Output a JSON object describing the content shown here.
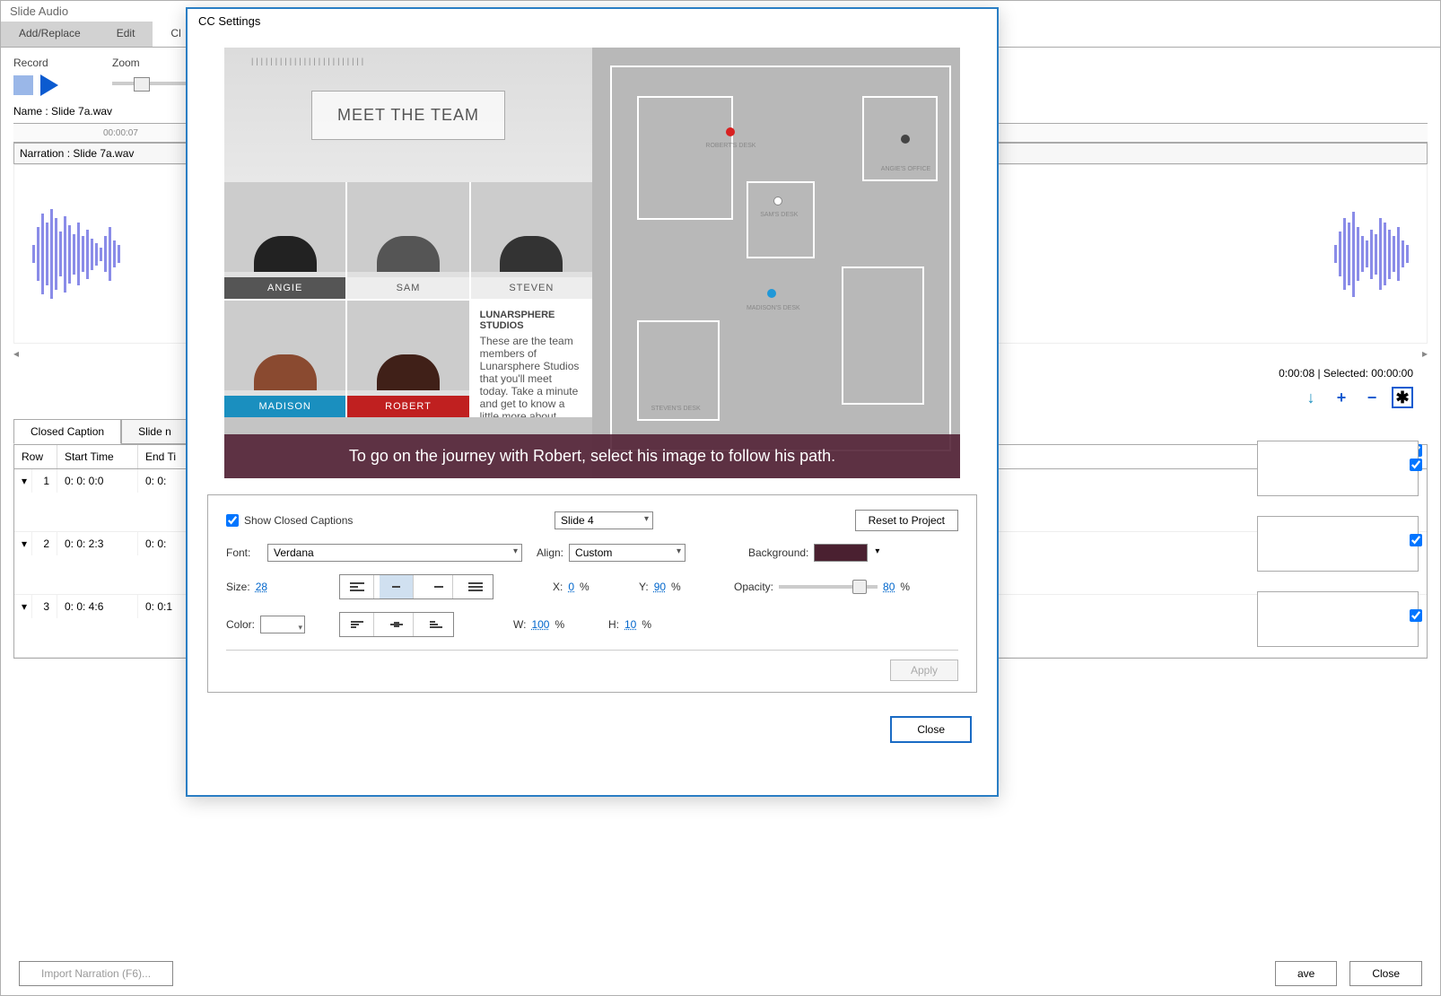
{
  "bgWindow": {
    "title": "Slide Audio",
    "tabs": [
      "Add/Replace",
      "Edit",
      "Cl"
    ],
    "toolbarLabels": {
      "record": "Record",
      "zoom": "Zoom"
    },
    "nameLine": "Name :  Slide 7a.wav",
    "rulerTime": "00:00:07",
    "narrationLine": "Narration : Slide 7a.wav",
    "status": "0:00:08  |  Selected:  00:00:00",
    "subTabs": [
      "Closed Caption",
      "Slide n"
    ],
    "tableHeaders": {
      "row": "Row",
      "start": "Start Time",
      "end": "End Ti"
    },
    "rows": [
      {
        "n": "1",
        "st": "0: 0: 0:0",
        "et": "0: 0:"
      },
      {
        "n": "2",
        "st": "0: 0: 2:3",
        "et": "0: 0:"
      },
      {
        "n": "3",
        "st": "0: 0: 4:6",
        "et": "0: 0:1"
      }
    ],
    "importBtn": "Import Narration (F6)...",
    "footer": {
      "save": "ave",
      "close": "Close"
    }
  },
  "modal": {
    "title": "CC Settings",
    "preview": {
      "heroTitle": "MEET THE TEAM",
      "team": {
        "angie": "ANGIE",
        "sam": "SAM",
        "steven": "STEVEN",
        "madison": "MADISON",
        "robert": "ROBERT"
      },
      "desc": {
        "t1": "LUNARSPHERE STUDIOS",
        "t2": "These are the team members of Lunarsphere Studios that you'll meet today. Take a minute and get to know a little more about them by selecting"
      },
      "floorplan": {
        "roberts": "ROBERT'S DESK",
        "angies": "ANGIE'S OFFICE",
        "sams": "SAM'S DESK",
        "madisons": "MADISON'S DESK",
        "stevens": "STEVEN'S DESK"
      },
      "captionText": "To go on the journey with Robert, select his image to follow his path."
    },
    "settings": {
      "showCCLabel": "Show Closed Captions",
      "slideDropdown": "Slide 4",
      "resetBtn": "Reset to Project",
      "fontLabel": "Font:",
      "fontValue": "Verdana",
      "alignLabel": "Align:",
      "alignValue": "Custom",
      "bgLabel": "Background:",
      "sizeLabel": "Size:",
      "sizeValue": "28",
      "xLabel": "X:",
      "xValue": "0",
      "yLabel": "Y:",
      "yValue": "90",
      "opacityLabel": "Opacity:",
      "opacityValue": "80",
      "colorLabel": "Color:",
      "wLabel": "W:",
      "wValue": "100",
      "hLabel": "H:",
      "hValue": "10",
      "pct": "%",
      "applyBtn": "Apply",
      "closeBtn": "Close"
    }
  }
}
